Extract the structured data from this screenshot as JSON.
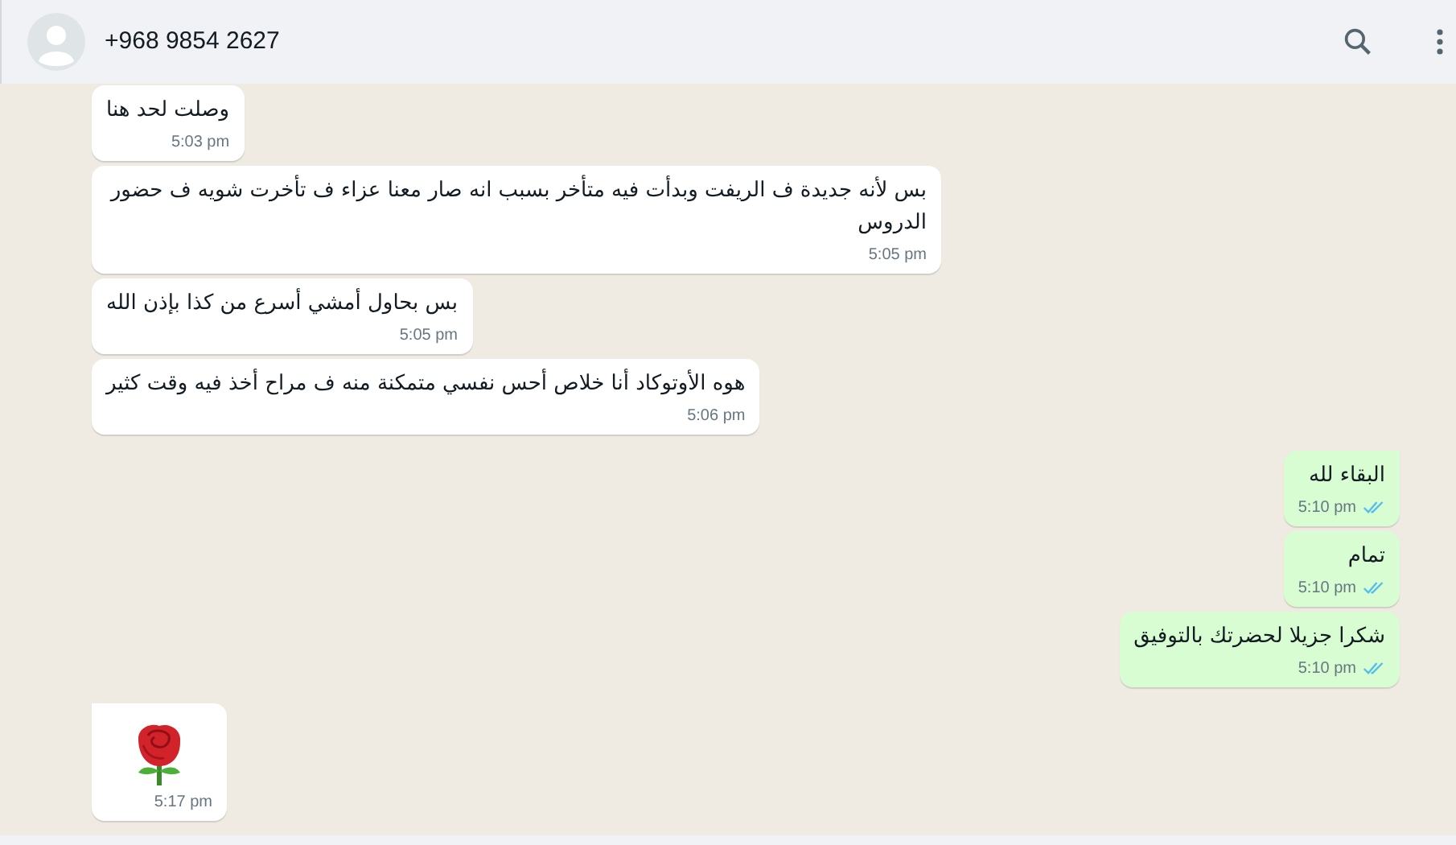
{
  "header": {
    "contact": "+968 9854 2627"
  },
  "messages": [
    {
      "kind": "text",
      "outgoing": false,
      "tail": false,
      "text": "وصلت لحد هنا",
      "time": "5:03 pm"
    },
    {
      "kind": "text",
      "outgoing": false,
      "tail": false,
      "text": "بس لأنه جديدة ف الريفت وبدأت فيه متأخر بسبب انه صار معنا عزاء ف تأخرت شويه ف حضور الدروس",
      "time": "5:05 pm"
    },
    {
      "kind": "text",
      "outgoing": false,
      "tail": false,
      "text": "بس بحاول أمشي أسرع من كذا بإذن الله",
      "time": "5:05 pm"
    },
    {
      "kind": "text",
      "outgoing": false,
      "tail": false,
      "text": "هوه الأوتوكاد أنا خلاص أحس نفسي متمكنة منه ف مراح أخذ فيه وقت كثير",
      "time": "5:06 pm"
    },
    {
      "kind": "text",
      "outgoing": true,
      "tail": true,
      "text": "البقاء لله",
      "time": "5:10 pm",
      "read": true
    },
    {
      "kind": "text",
      "outgoing": true,
      "tail": false,
      "text": "تمام",
      "time": "5:10 pm",
      "read": true
    },
    {
      "kind": "text",
      "outgoing": true,
      "tail": false,
      "text": "شكرا جزيلا لحضرتك بالتوفيق",
      "time": "5:10 pm",
      "read": true
    },
    {
      "kind": "sticker",
      "outgoing": false,
      "tail": true,
      "time": "5:17 pm"
    }
  ]
}
